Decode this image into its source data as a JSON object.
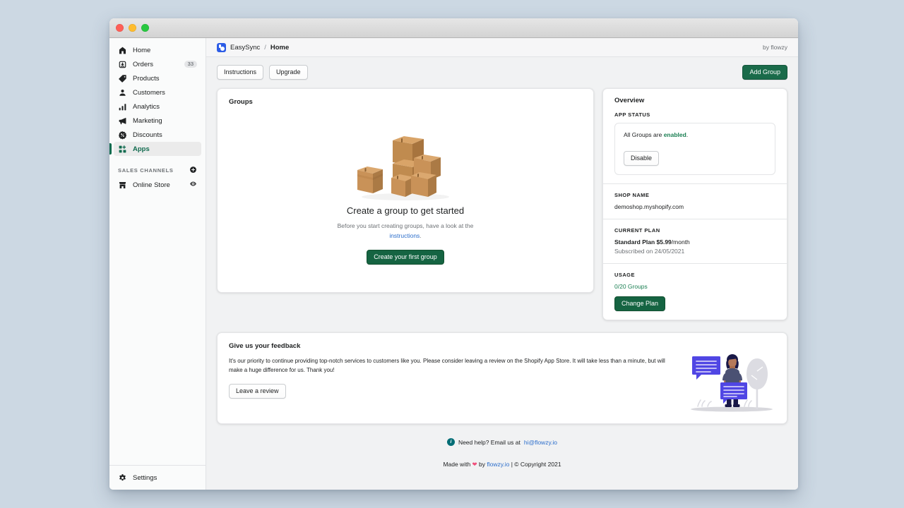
{
  "window": {
    "traffic_lights": [
      "close",
      "minimize",
      "maximize"
    ]
  },
  "sidebar": {
    "items": [
      {
        "label": "Home",
        "icon": "home-icon",
        "badge": "",
        "active": false
      },
      {
        "label": "Orders",
        "icon": "orders-icon",
        "badge": "33",
        "active": false
      },
      {
        "label": "Products",
        "icon": "products-tag-icon",
        "badge": "",
        "active": false
      },
      {
        "label": "Customers",
        "icon": "customers-icon",
        "badge": "",
        "active": false
      },
      {
        "label": "Analytics",
        "icon": "analytics-bars-icon",
        "badge": "",
        "active": false
      },
      {
        "label": "Marketing",
        "icon": "marketing-megaphone-icon",
        "badge": "",
        "active": false
      },
      {
        "label": "Discounts",
        "icon": "discounts-icon",
        "badge": "",
        "active": false
      },
      {
        "label": "Apps",
        "icon": "apps-grid-icon",
        "badge": "",
        "active": true
      }
    ],
    "section": {
      "title": "SALES CHANNELS",
      "add_icon": "plus-circle-icon",
      "channels": [
        {
          "label": "Online Store",
          "icon": "store-icon",
          "trailing_icon": "eye-icon"
        }
      ]
    },
    "settings": {
      "label": "Settings",
      "icon": "gear-icon"
    }
  },
  "topbar": {
    "app_name": "EasySync",
    "separator": "/",
    "page": "Home",
    "logo_icon": "easysync-logo-icon",
    "by": "by flowzy"
  },
  "action_bar": {
    "instructions_label": "Instructions",
    "upgrade_label": "Upgrade",
    "add_group_label": "Add Group"
  },
  "groups_card": {
    "title": "Groups",
    "illustration": "cardboard-boxes-illustration",
    "empty_title": "Create a group to get started",
    "empty_sub_before": "Before you start creating groups, have a look at the ",
    "empty_sub_link": "instructions",
    "empty_sub_after": ".",
    "cta_label": "Create your first group"
  },
  "overview_card": {
    "title": "Overview",
    "app_status": {
      "label": "APP STATUS",
      "text_before": "All Groups are ",
      "text_strong": "enabled",
      "text_after": ".",
      "button_label": "Disable"
    },
    "shop_name": {
      "label": "SHOP NAME",
      "value": "demoshop.myshopify.com"
    },
    "current_plan": {
      "label": "CURRENT PLAN",
      "plan_strong": "Standard Plan $5.99",
      "plan_rest": "/month",
      "subscribed": "Subscribed on 24/05/2021"
    },
    "usage": {
      "label": "USAGE",
      "value": "0/20 Groups",
      "button_label": "Change Plan"
    }
  },
  "feedback_card": {
    "title": "Give us your feedback",
    "body": "It's our priority to continue providing top-notch services to customers like you. Please consider leaving a review on the Shopify App Store. It will take less than a minute, but will make a huge difference for us. Thank you!",
    "button_label": "Leave a review",
    "illustration": "person-with-speech-bubbles-illustration"
  },
  "footer": {
    "info_icon": "info-icon",
    "help_text": "Need help? Email us at ",
    "help_email": "hi@flowzy.io",
    "made_with_before": "Made with ",
    "heart_icon": "heart-icon",
    "made_with_after": " by ",
    "site_link": "flowzy.io",
    "copyright": " | © Copyright 2021"
  },
  "colors": {
    "brand_green": "#1a6b4a",
    "link_blue": "#2c6ecb",
    "logo_blue": "#2c5ce6",
    "status_green": "#1a7f52",
    "page_background": "#ccd8e3",
    "content_background": "#f1f2f3"
  }
}
